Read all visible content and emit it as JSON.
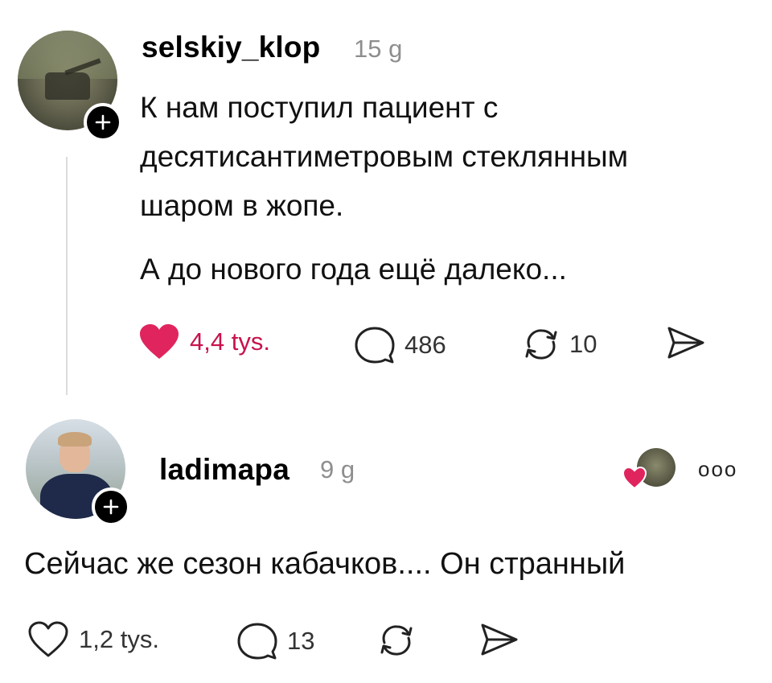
{
  "post": {
    "username": "selskiy_klop",
    "time": "15 g",
    "text_lines": [
      "К нам поступил пациент с",
      "десятисантиметровым стеклянным",
      "шаром в жопе."
    ],
    "text_para2": "А до нового года ещё далеко...",
    "likes": "4,4 tys.",
    "comments": "486",
    "reposts": "10"
  },
  "reply": {
    "username": "ladimapa",
    "time": "9 g",
    "text": "Сейчас же сезон кабачков.... Он странный",
    "likes": "1,2 tys.",
    "comments": "13",
    "more": "ooo"
  },
  "colors": {
    "like_active": "#e0245e",
    "like_count_active": "#c8124c",
    "muted": "#8e8e8e"
  },
  "icons": {
    "like_active": "heart-filled",
    "like": "heart-outline",
    "comment": "speech-bubble",
    "repost": "repost-arrows",
    "share": "paper-plane",
    "follow": "plus"
  }
}
